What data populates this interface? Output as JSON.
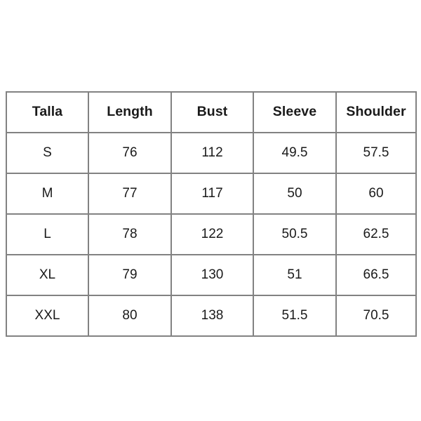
{
  "chart_data": {
    "type": "table",
    "title": "",
    "columns": [
      "Talla",
      "Length",
      "Bust",
      "Sleeve",
      "Shoulder"
    ],
    "rows": [
      {
        "cells": [
          "S",
          "76",
          "112",
          "49.5",
          "57.5"
        ]
      },
      {
        "cells": [
          "M",
          "77",
          "117",
          "50",
          "60"
        ]
      },
      {
        "cells": [
          "L",
          "78",
          "122",
          "50.5",
          "62.5"
        ]
      },
      {
        "cells": [
          "XL",
          "79",
          "130",
          "51",
          "66.5"
        ]
      },
      {
        "cells": [
          "XXL",
          "80",
          "138",
          "51.5",
          "70.5"
        ]
      }
    ],
    "series": [
      {
        "name": "Length",
        "categories": [
          "S",
          "M",
          "L",
          "XL",
          "XXL"
        ],
        "values": [
          76,
          77,
          78,
          79,
          80
        ]
      },
      {
        "name": "Bust",
        "categories": [
          "S",
          "M",
          "L",
          "XL",
          "XXL"
        ],
        "values": [
          112,
          117,
          122,
          130,
          138
        ]
      },
      {
        "name": "Sleeve",
        "categories": [
          "S",
          "M",
          "L",
          "XL",
          "XXL"
        ],
        "values": [
          49.5,
          50,
          50.5,
          51,
          51.5
        ]
      },
      {
        "name": "Shoulder",
        "categories": [
          "S",
          "M",
          "L",
          "XL",
          "XXL"
        ],
        "values": [
          57.5,
          60,
          62.5,
          66.5,
          70.5
        ]
      }
    ],
    "xlabel": "",
    "ylabel": "",
    "grid": true,
    "legend_position": "none"
  },
  "style": {
    "background": "#ffffff",
    "border_color": "#828282",
    "text_color": "#1a1a1a"
  }
}
